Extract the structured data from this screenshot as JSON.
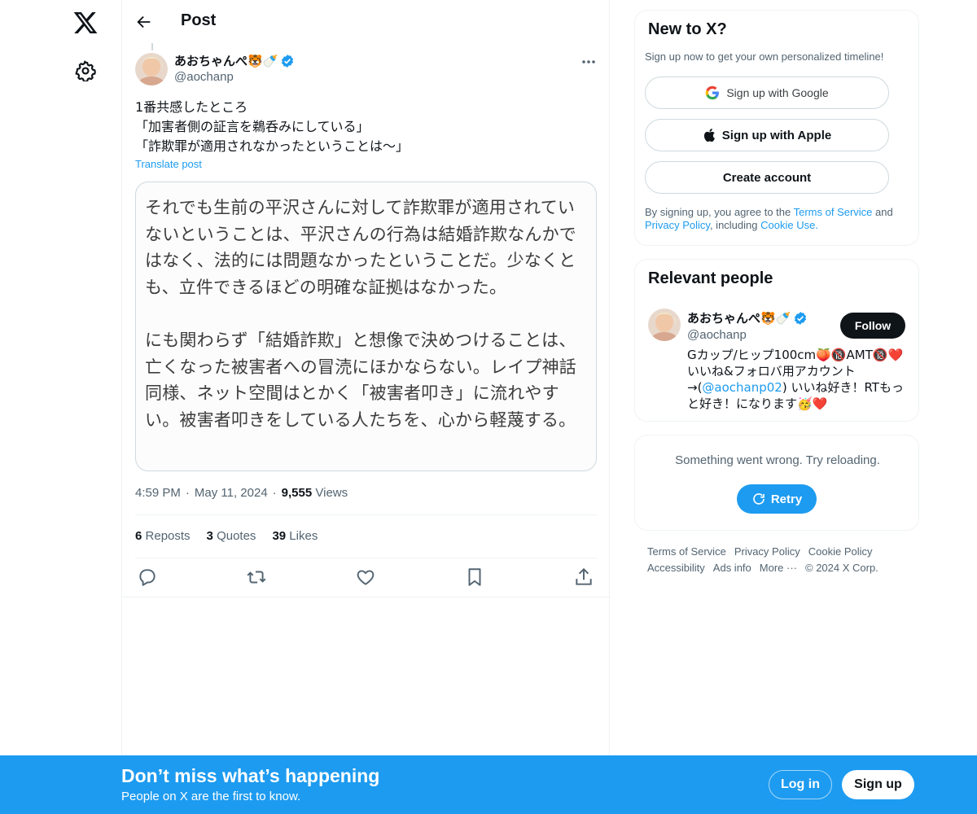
{
  "colors": {
    "accent": "#1d9bf0",
    "text": "#0f1419",
    "muted": "#536471",
    "verified": "#1d9bf0",
    "follow_bg": "#0f1419"
  },
  "icons": {
    "logo": "x-logo-icon",
    "settings": "gear-icon",
    "back": "arrow-left-icon",
    "verified": "verified-badge-icon",
    "more": "more-icon",
    "reply": "reply-icon",
    "repost": "repost-icon",
    "like": "heart-icon",
    "bookmark": "bookmark-icon",
    "share": "share-icon",
    "google": "google-icon",
    "apple": "apple-icon",
    "retry": "refresh-icon"
  },
  "header": {
    "title": "Post"
  },
  "tweet": {
    "author_name": "あおちゃんぺ🐯🍼",
    "author_handle": "@aochanp",
    "text": "1番共感したところ\n「加害者側の証言を鵜呑みにしている」\n「詐欺罪が適用されなかったということは〜」",
    "translate": "Translate post",
    "media_text": "それでも生前の平沢さんに対して詐欺罪が適用されていないということは、平沢さんの行為は結婚詐欺なんかではなく、法的には問題なかったということだ。少なくとも、立件できるほどの明確な証拠はなかった。\n\nにも関わらず「結婚詐欺」と想像で決めつけることは、亡くなった被害者への冒涜にほかならない。レイプ神話同様、ネット空間はとかく「被害者叩き」に流れやすい。被害者叩きをしている人たちを、心から軽蔑する。",
    "time": "4:59 PM",
    "date": "May 11, 2024",
    "views_count": "9,555",
    "views_label": "Views",
    "reposts_count": "6",
    "reposts_label": "Reposts",
    "quotes_count": "3",
    "quotes_label": "Quotes",
    "likes_count": "39",
    "likes_label": "Likes"
  },
  "signup_card": {
    "title": "New to X?",
    "subtitle": "Sign up now to get your own personalized timeline!",
    "google_label": "Sign up with Google",
    "apple_label": "Sign up with Apple",
    "create_label": "Create account",
    "legal_prefix": "By signing up, you agree to the ",
    "terms": "Terms of Service",
    "and": " and",
    "privacy": "Privacy Policy",
    "including": ", including ",
    "cookie": "Cookie Use",
    "period": "."
  },
  "people_card": {
    "title": "Relevant people",
    "name": "あおちゃんぺ🐯🍼",
    "handle": "@aochanp",
    "follow_label": "Follow",
    "bio_part1": "Gカップ/ヒップ100cm🍑🔞AMT🔞❤️いいね&フォロバ用アカウント→(",
    "bio_link": "@aochanp02",
    "bio_part2": ") いいね好き！RTもっと好き！になります🥳❤️"
  },
  "error_card": {
    "text": "Something went wrong. Try reloading.",
    "retry_label": "Retry"
  },
  "footer": {
    "terms": "Terms of Service",
    "privacy": "Privacy Policy",
    "cookie": "Cookie Policy",
    "accessibility": "Accessibility",
    "ads": "Ads info",
    "more": "More ···",
    "copyright": "© 2024 X Corp."
  },
  "banner": {
    "title": "Don’t miss what’s happening",
    "subtitle": "People on X are the first to know.",
    "login_label": "Log in",
    "signup_label": "Sign up"
  }
}
